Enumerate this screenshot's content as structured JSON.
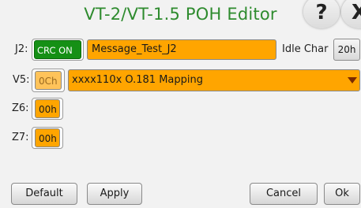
{
  "dialog": {
    "title": "VT-2/VT-1.5 POH Editor",
    "help_label": "?",
    "close_label": "X"
  },
  "j2": {
    "label": "J2:",
    "crc_toggle": "CRC ON",
    "message": "Message_Test_J2",
    "idle_char_label": "Idle Char",
    "idle_char_value": "20h"
  },
  "v5": {
    "label": "V5:",
    "value": "0Ch",
    "mapping_selected": "xxxx110x O.181 Mapping"
  },
  "z6": {
    "label": "Z6:",
    "value": "00h"
  },
  "z7": {
    "label": "Z7:",
    "value": "00h"
  },
  "buttons": {
    "default": "Default",
    "apply": "Apply",
    "cancel": "Cancel",
    "ok": "Ok"
  },
  "colors": {
    "title_green": "#2e8b2e",
    "field_orange": "#ffa500",
    "toggle_green": "#159015"
  }
}
